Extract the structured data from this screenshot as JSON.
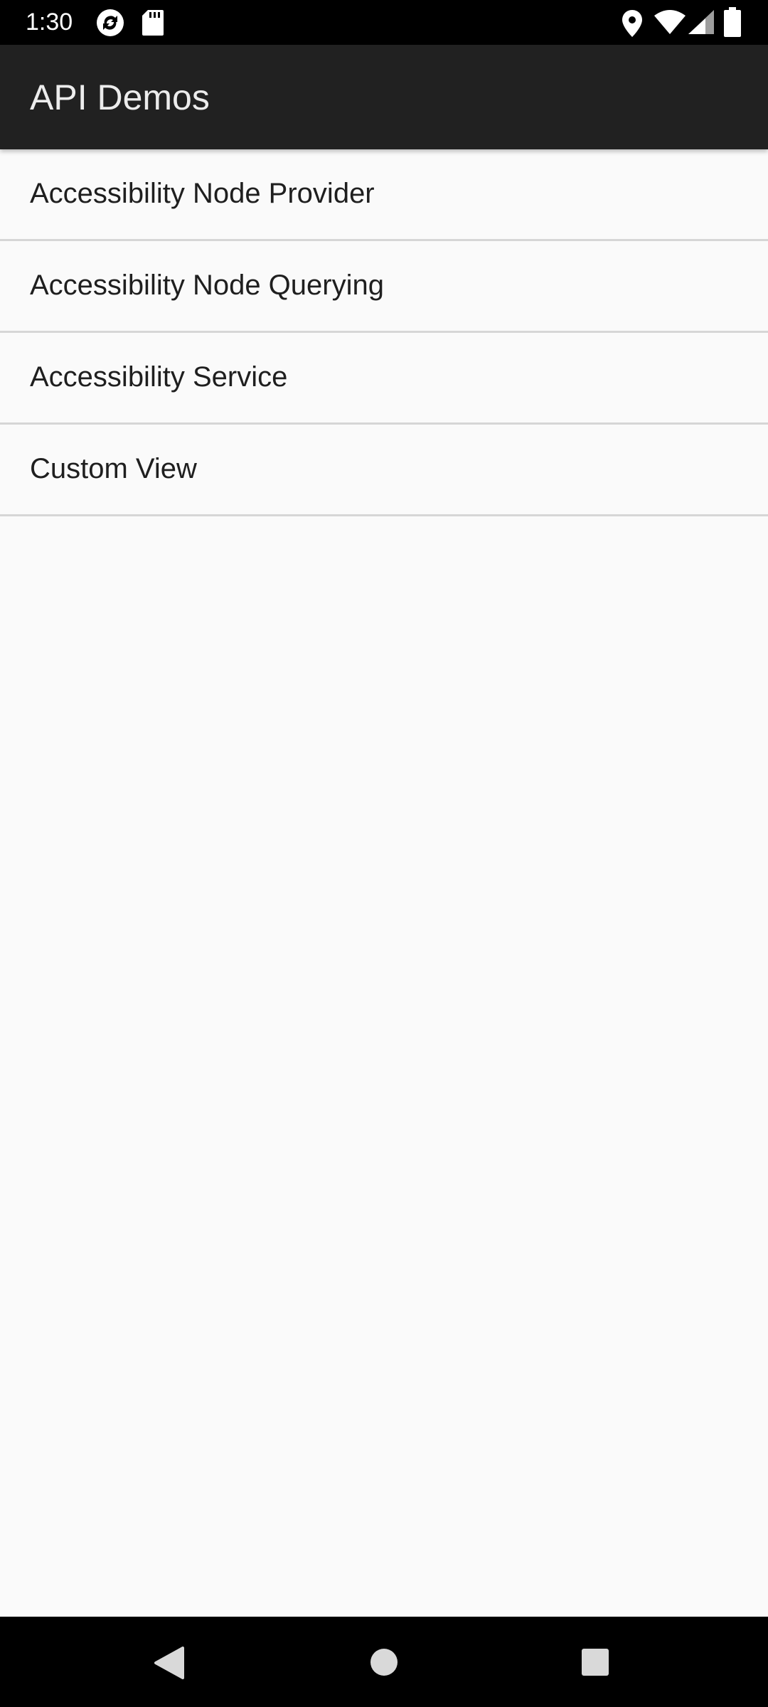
{
  "status_bar": {
    "time": "1:30",
    "icons": [
      "sync-icon",
      "sd-card-icon",
      "location-icon",
      "wifi-icon",
      "signal-icon",
      "battery-icon"
    ],
    "background": "#000000"
  },
  "app_bar": {
    "title": "API Demos",
    "background": "#212121"
  },
  "list": {
    "items": [
      {
        "label": "Accessibility Node Provider"
      },
      {
        "label": "Accessibility Node Querying"
      },
      {
        "label": "Accessibility Service"
      },
      {
        "label": "Custom View"
      }
    ],
    "divider_color": "#d6d6d6"
  },
  "nav_bar": {
    "buttons": [
      "back-icon",
      "home-icon",
      "recents-icon"
    ],
    "background": "#000000"
  }
}
